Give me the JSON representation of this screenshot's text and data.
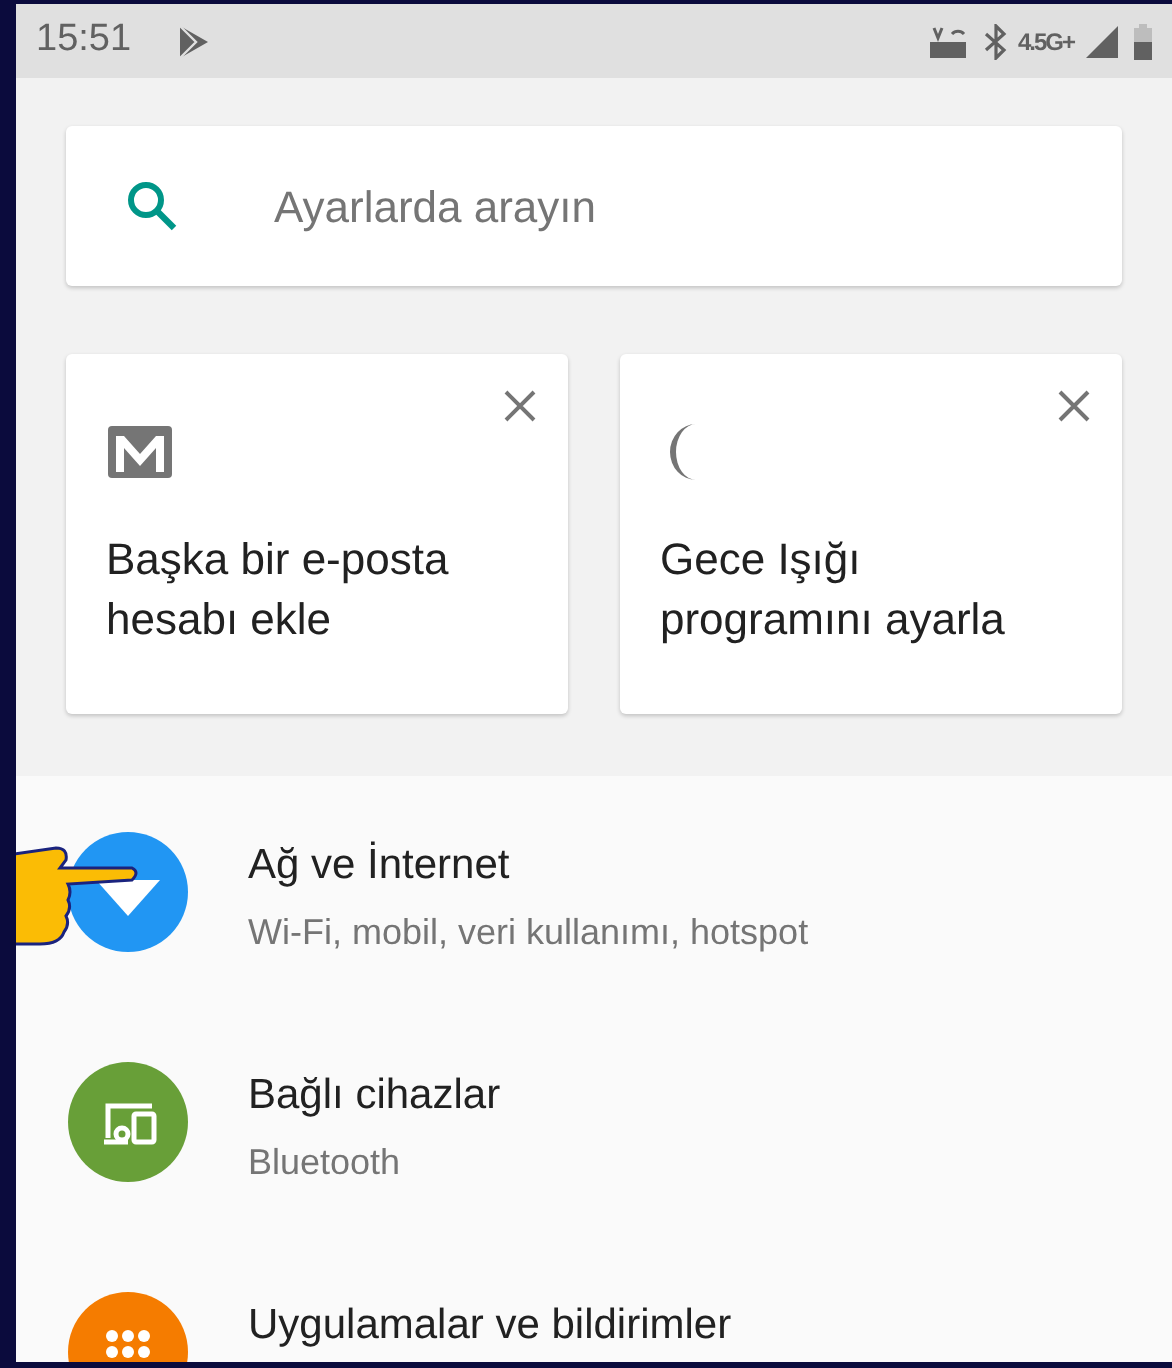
{
  "status_bar": {
    "time": "15:51",
    "network": "4.5G+"
  },
  "search": {
    "placeholder": "Ayarlarda arayın"
  },
  "suggestions": [
    {
      "kind": "mail",
      "text": "Başka bir e-posta hesabı ekle"
    },
    {
      "kind": "moon",
      "text": "Gece Işığı programını ayarla"
    }
  ],
  "settings": [
    {
      "kind": "wifi",
      "color": "#2196f3",
      "title": "Ağ ve İnternet",
      "subtitle": "Wi-Fi, mobil, veri kullanımı, hotspot",
      "pointed": true
    },
    {
      "kind": "devices",
      "color": "#689f38",
      "title": "Bağlı cihazlar",
      "subtitle": "Bluetooth",
      "pointed": false
    },
    {
      "kind": "apps",
      "color": "#f57c00",
      "title": "Uygulamalar ve bildirimler",
      "pointed": false
    }
  ]
}
